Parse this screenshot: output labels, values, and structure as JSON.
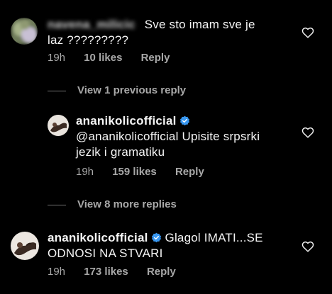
{
  "comments": [
    {
      "username": "navena_milicic",
      "text_line1": "Sve sto imam sve je",
      "text_line2": "laz ?????????",
      "time": "19h",
      "likes": "10 likes",
      "reply": "Reply"
    },
    {
      "username": "ananikolicofficial",
      "text_line1": "@ananikolicofficial Upisite srpsrki",
      "text_line2": "jezik i gramatiku",
      "time": "19h",
      "likes": "159 likes",
      "reply": "Reply"
    },
    {
      "username": "ananikolicofficial",
      "text_line1": "Glagol IMATI...SE",
      "text_line2": "ODNOSI NA STVARI",
      "time": "19h",
      "likes": "173 likes",
      "reply": "Reply"
    }
  ],
  "view_previous": "View 1 previous reply",
  "view_more": "View 8 more replies",
  "colors": {
    "background": "#000000",
    "text": "#f5f5f5",
    "secondary": "#a8a8a8",
    "verified": "#3897f0"
  },
  "icons": [
    "heart-icon",
    "verified-badge-icon"
  ]
}
